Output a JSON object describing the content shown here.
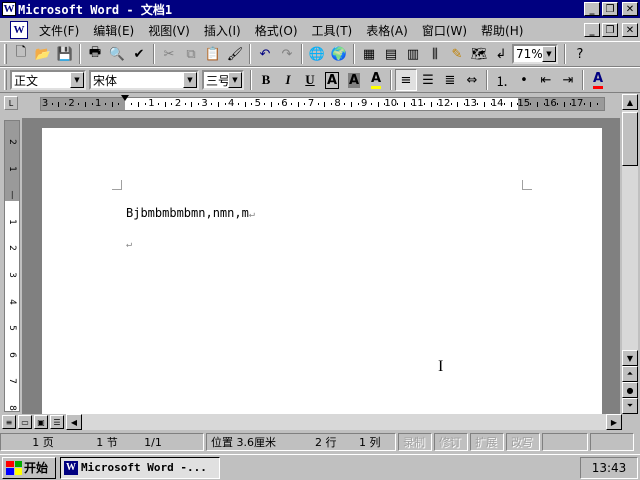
{
  "window": {
    "title": "Microsoft Word - 文档1",
    "min": "_",
    "max": "❐",
    "close": "✕"
  },
  "menubar": {
    "items": [
      "文件(F)",
      "编辑(E)",
      "视图(V)",
      "插入(I)",
      "格式(O)",
      "工具(T)",
      "表格(A)",
      "窗口(W)",
      "帮助(H)"
    ],
    "doc_min": "_",
    "doc_max": "❐",
    "doc_close": "✕"
  },
  "toolbar_standard": {
    "zoom": "71%",
    "icons": [
      "new-document",
      "open-folder",
      "save",
      "print",
      "print-preview",
      "spelling",
      "cut",
      "copy",
      "paste",
      "format-painter",
      "undo",
      "redo",
      "hyperlink",
      "web-toolbar",
      "tables-borders",
      "insert-table",
      "insert-excel",
      "columns",
      "drawing",
      "document-map",
      "show-hide",
      "help"
    ]
  },
  "toolbar_formatting": {
    "style": "正文",
    "font": "宋体",
    "size": "三号",
    "bold": "B",
    "italic": "I",
    "underline": "U",
    "char_border": "A",
    "char_shading": "A",
    "highlight": "A",
    "font_color": "A"
  },
  "ruler": {
    "labels": [
      "3",
      "2",
      "1",
      "",
      "1",
      "2",
      "3",
      "4",
      "5",
      "6",
      "7",
      "8",
      "9",
      "10",
      "11",
      "12",
      "13",
      "14",
      "15",
      "16",
      "17"
    ]
  },
  "vruler": {
    "labels": [
      "2",
      "1",
      "",
      "1",
      "2",
      "3",
      "4",
      "5",
      "6",
      "7",
      "8"
    ]
  },
  "document": {
    "line1": "Bjbmbmbmbmn,nmn,m",
    "para_mark": "↵"
  },
  "statusbar": {
    "page": "1 页",
    "section": "1 节",
    "pages": "1/1",
    "position": "位置 3.6厘米",
    "line": "2 行",
    "column": "1 列",
    "rec": "录制",
    "trk": "修订",
    "ext": "扩展",
    "ovr": "改写"
  },
  "taskbar": {
    "start": "开始",
    "task": "Microsoft Word -...",
    "clock": "13:43"
  },
  "colors": {
    "titlebar": "#000080",
    "face": "#c0c0c0",
    "font_color_red": "#ff0000",
    "highlight_yellow": "#ffff00"
  }
}
